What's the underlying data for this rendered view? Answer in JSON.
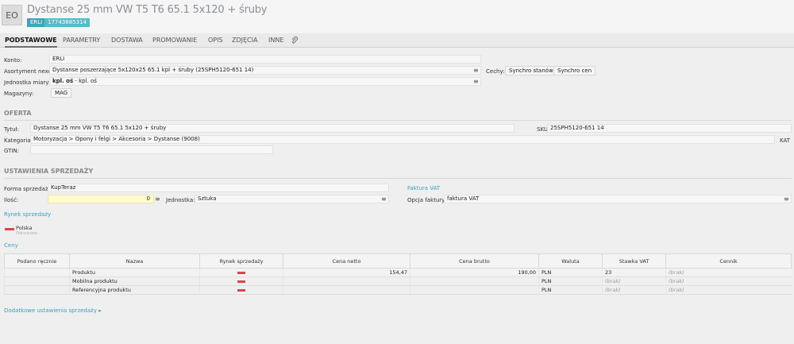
{
  "header": {
    "badge": "EO",
    "title": "Dystanse 25 mm VW T5 T6 65.1 5x120 + śruby",
    "tag_erli": "ERLI",
    "tag_id": "17743885314"
  },
  "tabs": [
    {
      "label": "PODSTAWOWE"
    },
    {
      "label": "PARAMETRY"
    },
    {
      "label": "DOSTAWA"
    },
    {
      "label": "PROMOWANIE"
    },
    {
      "label": "OPIS"
    },
    {
      "label": "ZDJĘCIA"
    },
    {
      "label": "INNE"
    }
  ],
  "basic": {
    "konto_label": "Konto:",
    "konto_value": "ERLI",
    "asortyment_label": "Asortyment nexo:",
    "asortyment_value": "Dystanse poszerzające 5x120x25 65.1 kpl + śruby (25SPH5120-651 14)",
    "jednostka_label": "Jednostka miary:",
    "jednostka_value_bold": "kpl. oś",
    "jednostka_value_rest": " - kpl. oś",
    "magazyny_label": "Magazyny:",
    "magazyny_value": "MAG",
    "cechy_label": "Cechy:",
    "btn_synchro_stanow": "Synchro stanów",
    "btn_synchro_cen": "Synchro cen"
  },
  "oferta": {
    "section": "OFERTA",
    "tytul_label": "Tytuł:",
    "tytul_value": "Dystanse 25 mm VW T5 T6 65.1 5x120 + śruby",
    "sku_label": "SKU:",
    "sku_value": "25SPH5120-651 14",
    "kategoria_label": "Kategoria:",
    "kategoria_value": "Motoryzacja > Opony i felgi > Akcesoria > Dystanse (9008)",
    "kat_short": "KAT",
    "gtin_label": "GTIN:",
    "gtin_value": ""
  },
  "sprzedaz": {
    "section": "USTAWIENIA SPRZEDAŻY",
    "forma_label": "Forma sprzedaży:",
    "forma_value": "KupTeraz",
    "ilosc_label": "Ilość:",
    "ilosc_value": "0",
    "jednostka_label": "Jednostka:",
    "jednostka_value": "Sztuka",
    "faktura_link": "Faktura VAT",
    "opcja_label": "Opcja faktury:",
    "opcja_value": "faktura VAT",
    "rynek_link": "Rynek sprzedaży",
    "rynek_country": "Polska",
    "rynek_status": "Odrzucono",
    "ceny_link": "Ceny",
    "dodatkowe_link": "Dodatkowe ustawienia sprzedaży ▸"
  },
  "prices": {
    "headers": [
      "Podano ręcznie",
      "Nazwa",
      "Rynek sprzedaży",
      "Cena netto",
      "Cena brutto",
      "Waluta",
      "Stawka VAT",
      "Cennik"
    ],
    "rows": [
      {
        "name": "Produktu",
        "netto": "154,47",
        "brutto": "190,00",
        "waluta": "PLN",
        "vat": "23",
        "cennik": "(brak)"
      },
      {
        "name": "Mobilna produktu",
        "netto": "",
        "brutto": "",
        "waluta": "PLN",
        "vat": "(brak)",
        "cennik": "(brak)"
      },
      {
        "name": "Referencyjna produktu",
        "netto": "",
        "brutto": "",
        "waluta": "PLN",
        "vat": "(brak)",
        "cennik": "(brak)"
      }
    ]
  },
  "colors": {
    "accent": "#3aa7b5",
    "link": "#3a9fc0",
    "flag": "#d9454f",
    "highlight_input": "#fffbd0"
  }
}
